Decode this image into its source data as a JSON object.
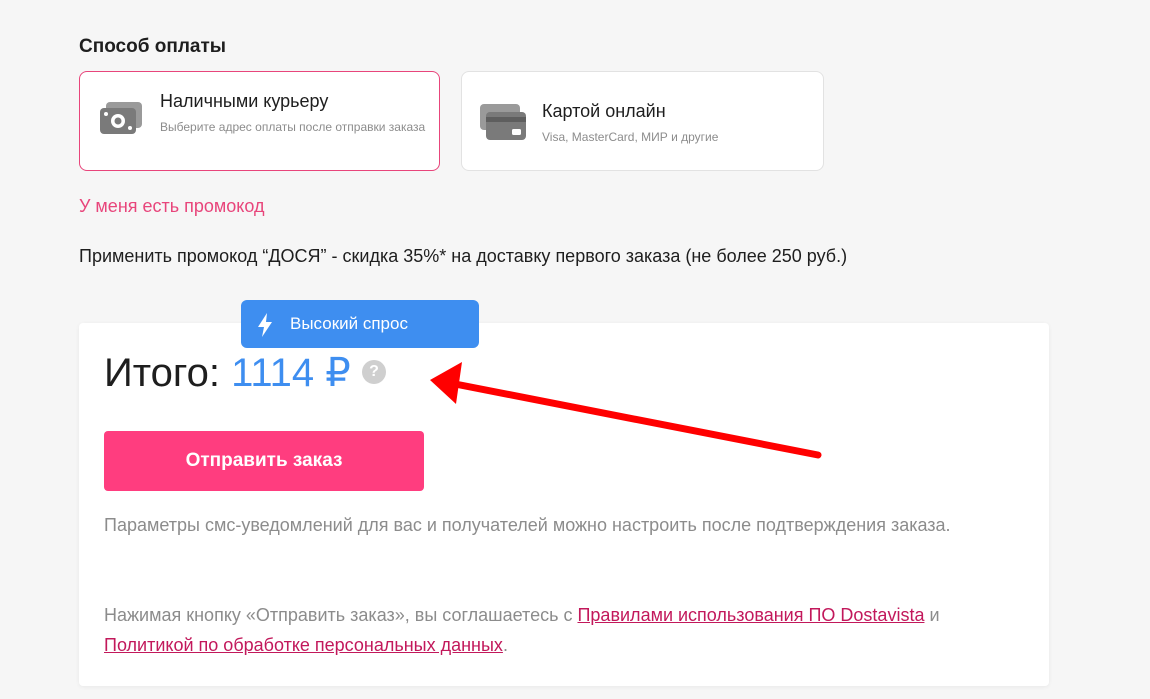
{
  "payment": {
    "section_title": "Способ оплаты",
    "options": [
      {
        "title": "Наличными курьеру",
        "description": "Выберите адрес оплаты после отправки заказа",
        "icon": "cash-icon",
        "selected": true
      },
      {
        "title": "Картой онлайн",
        "description": "Visa, MasterCard, МИР и другие",
        "icon": "credit-card-icon",
        "selected": false
      }
    ]
  },
  "promo": {
    "link_label": "У меня есть промокод",
    "offer_text": "Применить промокод “ДОСЯ” - скидка 35%* на доставку первого заказа (не более 250 руб.)"
  },
  "total": {
    "badge_label": "Высокий спрос",
    "label": "Итого:",
    "amount": "1114 ₽",
    "help_symbol": "?",
    "submit_label": "Отправить заказ",
    "sms_note": "Параметры смс-уведомлений для вас и получателей можно настроить после подтверждения заказа.",
    "agreement_prefix": "Нажимая кнопку «Отправить заказ», вы соглашаетесь с",
    "rules_link": "Правилами использования ПО Dostavista",
    "agreement_and": "и",
    "privacy_link": "Политикой по обработке персональных данных",
    "agreement_suffix": "."
  },
  "colors": {
    "accent_pink": "#ff3d7f",
    "link_pink": "#e8457b",
    "price_blue": "#3e8ef0",
    "annotation_red": "#ff0000"
  }
}
